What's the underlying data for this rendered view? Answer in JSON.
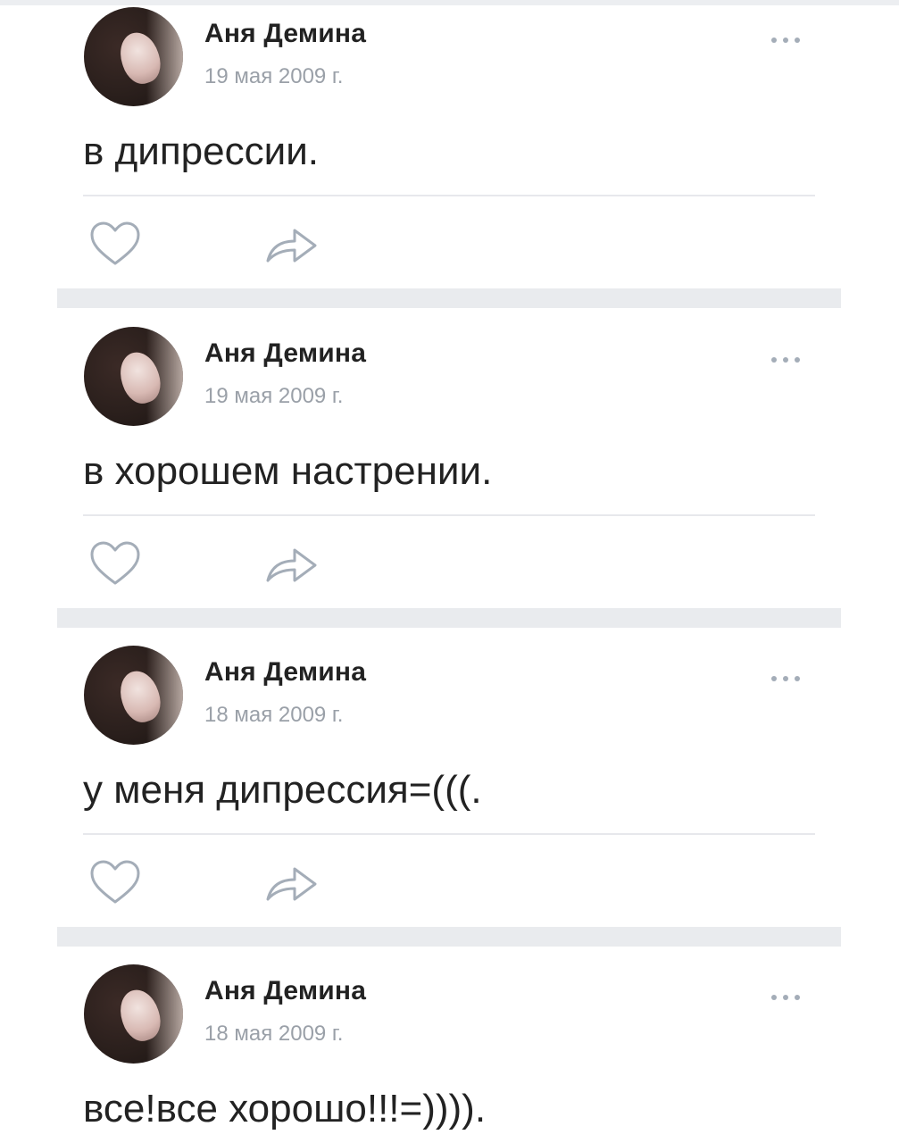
{
  "posts": [
    {
      "author": "Аня Демина",
      "date": "19 мая 2009 г.",
      "text": "в дипрессии."
    },
    {
      "author": "Аня Демина",
      "date": "19 мая 2009 г.",
      "text": "в хорошем настрении."
    },
    {
      "author": "Аня Демина",
      "date": "18 мая 2009 г.",
      "text": "у меня дипрессия=(((."
    },
    {
      "author": "Аня Демина",
      "date": "18 мая 2009 г.",
      "text": "все!все хорошо!!!=))))."
    }
  ],
  "icons": {
    "like": "heart-icon",
    "share": "share-arrow-icon",
    "more": "more-dots-icon"
  },
  "colors": {
    "text": "#222222",
    "date": "#9aa0a8",
    "icon": "#a4adb8",
    "separator": "#e9ebee"
  }
}
